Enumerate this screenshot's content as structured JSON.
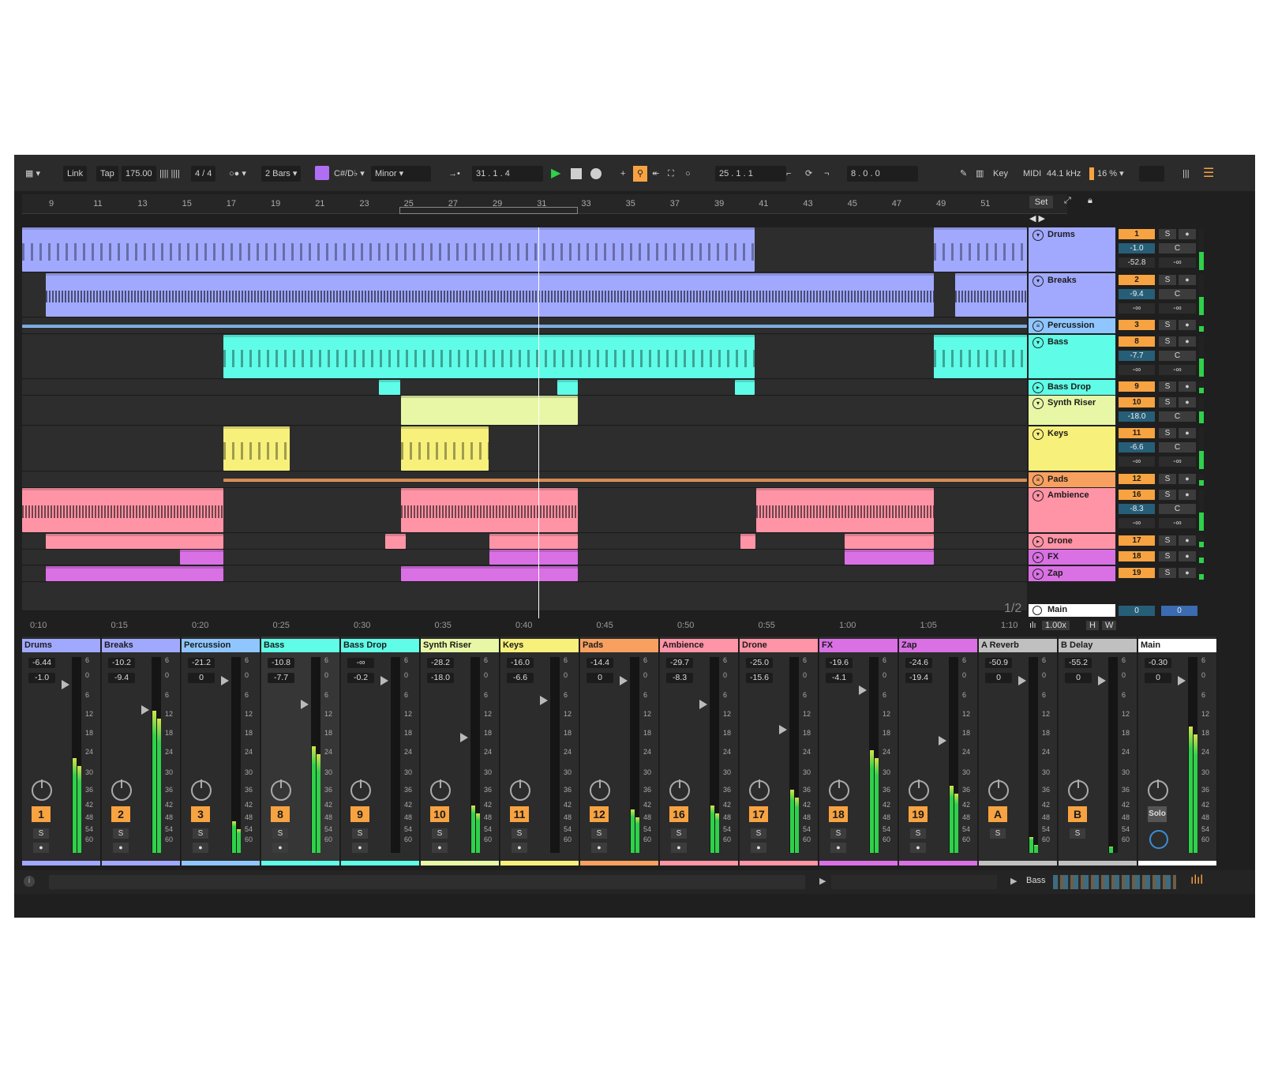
{
  "control_bar": {
    "link": "Link",
    "tap": "Tap",
    "tempo": "175.00",
    "time_sig_num": "4",
    "time_sig_den": "4",
    "quantize": "2 Bars",
    "key": "C#/D♭",
    "scale": "Minor",
    "position": [
      "31",
      "1",
      "4"
    ],
    "loop_start": [
      "25",
      "1",
      "1"
    ],
    "loop_length": [
      "8",
      "0",
      "0"
    ],
    "key_label": "Key",
    "midi_label": "MIDI",
    "sample_rate": "44.1 kHz",
    "cpu": "16 %"
  },
  "ruler": {
    "bars": [
      "9",
      "11",
      "13",
      "15",
      "17",
      "19",
      "21",
      "23",
      "25",
      "27",
      "29",
      "31",
      "33",
      "35",
      "37",
      "39",
      "41",
      "43",
      "45",
      "47",
      "49",
      "51"
    ],
    "set_label": "Set"
  },
  "time_ruler": [
    "0:10",
    "0:15",
    "0:20",
    "0:25",
    "0:30",
    "0:35",
    "0:40",
    "0:45",
    "0:50",
    "0:55",
    "1:00",
    "1:05",
    "1:10"
  ],
  "page_indicator": "1/2",
  "colors": {
    "drums": "#a1a9ff",
    "bass": "#5ffce7",
    "keys": "#f7f07a",
    "riser": "#e7f7a6",
    "pads": "#f7a060",
    "ambience": "#ff94a6",
    "fx": "#d970e4",
    "accent": "#f7a341",
    "meter": "#2fd04a"
  },
  "tracks": [
    {
      "name": "Drums",
      "num": "1",
      "vol": "-1.0",
      "pan": "C",
      "extra1": "-52.8",
      "extra2": "-∞",
      "color": "#a1a9ff",
      "icon": "chevron-down-icon"
    },
    {
      "name": "Breaks",
      "num": "2",
      "vol": "-9.4",
      "pan": "C",
      "extra1": "-∞",
      "extra2": "-∞",
      "color": "#a1a9ff",
      "icon": "chevron-down-icon"
    },
    {
      "name": "Percussion",
      "num": "3",
      "color": "#8fc6ff",
      "icon": "group-icon"
    },
    {
      "name": "Bass",
      "num": "8",
      "vol": "-7.7",
      "pan": "C",
      "extra1": "-∞",
      "extra2": "-∞",
      "color": "#5ffce7",
      "icon": "chevron-down-icon"
    },
    {
      "name": "Bass Drop",
      "num": "9",
      "color": "#5ffce7",
      "icon": "play-icon"
    },
    {
      "name": "Synth Riser",
      "num": "10",
      "vol": "-18.0",
      "pan": "C",
      "color": "#e7f7a6",
      "icon": "chevron-down-icon"
    },
    {
      "name": "Keys",
      "num": "11",
      "vol": "-6.6",
      "pan": "C",
      "extra1": "-∞",
      "extra2": "-∞",
      "color": "#f7f07a",
      "icon": "chevron-down-icon"
    },
    {
      "name": "Pads",
      "num": "12",
      "color": "#f7a060",
      "icon": "group-icon"
    },
    {
      "name": "Ambience",
      "num": "16",
      "vol": "-8.3",
      "pan": "C",
      "extra1": "-∞",
      "extra2": "-∞",
      "color": "#ff94a6",
      "icon": "chevron-down-icon"
    },
    {
      "name": "Drone",
      "num": "17",
      "color": "#ff94a6",
      "icon": "play-icon"
    },
    {
      "name": "FX",
      "num": "18",
      "color": "#d970e4",
      "icon": "play-icon"
    },
    {
      "name": "Zap",
      "num": "19",
      "color": "#d970e4",
      "icon": "play-icon"
    }
  ],
  "main_track": {
    "name": "Main",
    "vol": "0",
    "pan": "0"
  },
  "zoom": "1.00x",
  "h_label": "H",
  "w_label": "W",
  "mixer": [
    {
      "name": "Drums",
      "db1": "-6.44",
      "db2": "-1.0",
      "num": "1",
      "color": "#a1a9ff"
    },
    {
      "name": "Breaks",
      "db1": "-10.2",
      "db2": "-9.4",
      "num": "2",
      "color": "#a1a9ff"
    },
    {
      "name": "Percussion",
      "db1": "-21.2",
      "db2": "0",
      "num": "3",
      "color": "#8fc6ff"
    },
    {
      "name": "Bass",
      "db1": "-10.8",
      "db2": "-7.7",
      "num": "8",
      "color": "#5ffce7"
    },
    {
      "name": "Bass Drop",
      "db1": "-∞",
      "db2": "-0.2",
      "num": "9",
      "color": "#5ffce7"
    },
    {
      "name": "Synth Riser",
      "db1": "-28.2",
      "db2": "-18.0",
      "num": "10",
      "color": "#e7f7a6"
    },
    {
      "name": "Keys",
      "db1": "-16.0",
      "db2": "-6.6",
      "num": "11",
      "color": "#f7f07a"
    },
    {
      "name": "Pads",
      "db1": "-14.4",
      "db2": "0",
      "num": "12",
      "color": "#f7a060"
    },
    {
      "name": "Ambience",
      "db1": "-29.7",
      "db2": "-8.3",
      "num": "16",
      "color": "#ff94a6"
    },
    {
      "name": "Drone",
      "db1": "-25.0",
      "db2": "-15.6",
      "num": "17",
      "color": "#ff94a6"
    },
    {
      "name": "FX",
      "db1": "-19.6",
      "db2": "-4.1",
      "num": "18",
      "color": "#d970e4"
    },
    {
      "name": "Zap",
      "db1": "-24.6",
      "db2": "-19.4",
      "num": "19",
      "color": "#d970e4"
    },
    {
      "name": "A Reverb",
      "db1": "-50.9",
      "db2": "0",
      "num": "A",
      "color": "#c0c0c0"
    },
    {
      "name": "B Delay",
      "db1": "-55.2",
      "db2": "0",
      "num": "B",
      "color": "#c0c0c0"
    },
    {
      "name": "Main",
      "db1": "-0.30",
      "db2": "0",
      "num": "Solo",
      "color": "#ffffff"
    }
  ],
  "meter_scale": [
    "6",
    "0",
    "6",
    "12",
    "18",
    "24",
    "30",
    "36",
    "42",
    "48",
    "54",
    "60"
  ],
  "status": {
    "device_label": "Bass"
  }
}
